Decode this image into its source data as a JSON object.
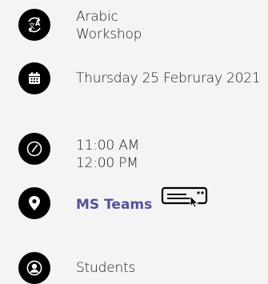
{
  "event": {
    "title_line1": "Arabic",
    "title_line2": "Workshop",
    "date": "Thursday 25 Februray 2021",
    "time_start": "11:00 AM",
    "time_end": "12:00 PM",
    "location_link": "MS Teams",
    "audience": "Students"
  },
  "icons": {
    "title": "translate-icon",
    "date": "calendar-icon",
    "time": "clock-icon",
    "location": "location-pin-icon",
    "online": "online-meeting-icon",
    "audience": "person-icon"
  },
  "colors": {
    "icon_background": "#000000",
    "link": "#54519a",
    "text": "#1a1a1a"
  }
}
